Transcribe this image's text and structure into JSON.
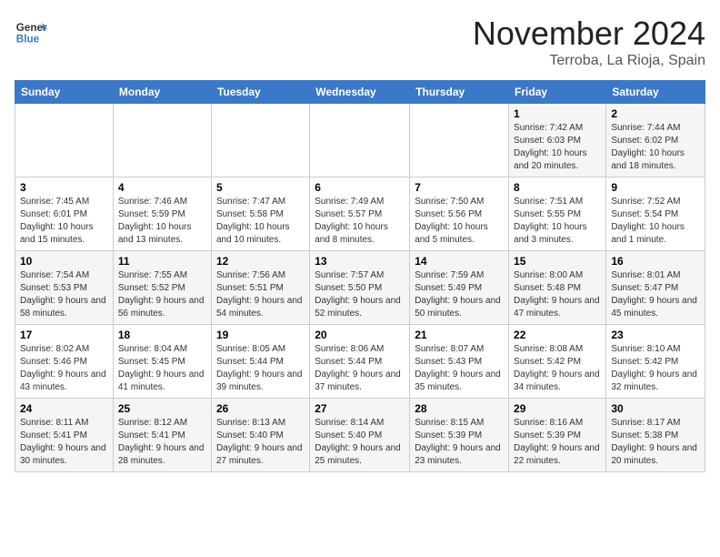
{
  "header": {
    "logo_line1": "General",
    "logo_line2": "Blue",
    "month": "November 2024",
    "location": "Terroba, La Rioja, Spain"
  },
  "weekdays": [
    "Sunday",
    "Monday",
    "Tuesday",
    "Wednesday",
    "Thursday",
    "Friday",
    "Saturday"
  ],
  "weeks": [
    [
      {
        "day": "",
        "info": ""
      },
      {
        "day": "",
        "info": ""
      },
      {
        "day": "",
        "info": ""
      },
      {
        "day": "",
        "info": ""
      },
      {
        "day": "",
        "info": ""
      },
      {
        "day": "1",
        "info": "Sunrise: 7:42 AM\nSunset: 6:03 PM\nDaylight: 10 hours and 20 minutes."
      },
      {
        "day": "2",
        "info": "Sunrise: 7:44 AM\nSunset: 6:02 PM\nDaylight: 10 hours and 18 minutes."
      }
    ],
    [
      {
        "day": "3",
        "info": "Sunrise: 7:45 AM\nSunset: 6:01 PM\nDaylight: 10 hours and 15 minutes."
      },
      {
        "day": "4",
        "info": "Sunrise: 7:46 AM\nSunset: 5:59 PM\nDaylight: 10 hours and 13 minutes."
      },
      {
        "day": "5",
        "info": "Sunrise: 7:47 AM\nSunset: 5:58 PM\nDaylight: 10 hours and 10 minutes."
      },
      {
        "day": "6",
        "info": "Sunrise: 7:49 AM\nSunset: 5:57 PM\nDaylight: 10 hours and 8 minutes."
      },
      {
        "day": "7",
        "info": "Sunrise: 7:50 AM\nSunset: 5:56 PM\nDaylight: 10 hours and 5 minutes."
      },
      {
        "day": "8",
        "info": "Sunrise: 7:51 AM\nSunset: 5:55 PM\nDaylight: 10 hours and 3 minutes."
      },
      {
        "day": "9",
        "info": "Sunrise: 7:52 AM\nSunset: 5:54 PM\nDaylight: 10 hours and 1 minute."
      }
    ],
    [
      {
        "day": "10",
        "info": "Sunrise: 7:54 AM\nSunset: 5:53 PM\nDaylight: 9 hours and 58 minutes."
      },
      {
        "day": "11",
        "info": "Sunrise: 7:55 AM\nSunset: 5:52 PM\nDaylight: 9 hours and 56 minutes."
      },
      {
        "day": "12",
        "info": "Sunrise: 7:56 AM\nSunset: 5:51 PM\nDaylight: 9 hours and 54 minutes."
      },
      {
        "day": "13",
        "info": "Sunrise: 7:57 AM\nSunset: 5:50 PM\nDaylight: 9 hours and 52 minutes."
      },
      {
        "day": "14",
        "info": "Sunrise: 7:59 AM\nSunset: 5:49 PM\nDaylight: 9 hours and 50 minutes."
      },
      {
        "day": "15",
        "info": "Sunrise: 8:00 AM\nSunset: 5:48 PM\nDaylight: 9 hours and 47 minutes."
      },
      {
        "day": "16",
        "info": "Sunrise: 8:01 AM\nSunset: 5:47 PM\nDaylight: 9 hours and 45 minutes."
      }
    ],
    [
      {
        "day": "17",
        "info": "Sunrise: 8:02 AM\nSunset: 5:46 PM\nDaylight: 9 hours and 43 minutes."
      },
      {
        "day": "18",
        "info": "Sunrise: 8:04 AM\nSunset: 5:45 PM\nDaylight: 9 hours and 41 minutes."
      },
      {
        "day": "19",
        "info": "Sunrise: 8:05 AM\nSunset: 5:44 PM\nDaylight: 9 hours and 39 minutes."
      },
      {
        "day": "20",
        "info": "Sunrise: 8:06 AM\nSunset: 5:44 PM\nDaylight: 9 hours and 37 minutes."
      },
      {
        "day": "21",
        "info": "Sunrise: 8:07 AM\nSunset: 5:43 PM\nDaylight: 9 hours and 35 minutes."
      },
      {
        "day": "22",
        "info": "Sunrise: 8:08 AM\nSunset: 5:42 PM\nDaylight: 9 hours and 34 minutes."
      },
      {
        "day": "23",
        "info": "Sunrise: 8:10 AM\nSunset: 5:42 PM\nDaylight: 9 hours and 32 minutes."
      }
    ],
    [
      {
        "day": "24",
        "info": "Sunrise: 8:11 AM\nSunset: 5:41 PM\nDaylight: 9 hours and 30 minutes."
      },
      {
        "day": "25",
        "info": "Sunrise: 8:12 AM\nSunset: 5:41 PM\nDaylight: 9 hours and 28 minutes."
      },
      {
        "day": "26",
        "info": "Sunrise: 8:13 AM\nSunset: 5:40 PM\nDaylight: 9 hours and 27 minutes."
      },
      {
        "day": "27",
        "info": "Sunrise: 8:14 AM\nSunset: 5:40 PM\nDaylight: 9 hours and 25 minutes."
      },
      {
        "day": "28",
        "info": "Sunrise: 8:15 AM\nSunset: 5:39 PM\nDaylight: 9 hours and 23 minutes."
      },
      {
        "day": "29",
        "info": "Sunrise: 8:16 AM\nSunset: 5:39 PM\nDaylight: 9 hours and 22 minutes."
      },
      {
        "day": "30",
        "info": "Sunrise: 8:17 AM\nSunset: 5:38 PM\nDaylight: 9 hours and 20 minutes."
      }
    ]
  ]
}
